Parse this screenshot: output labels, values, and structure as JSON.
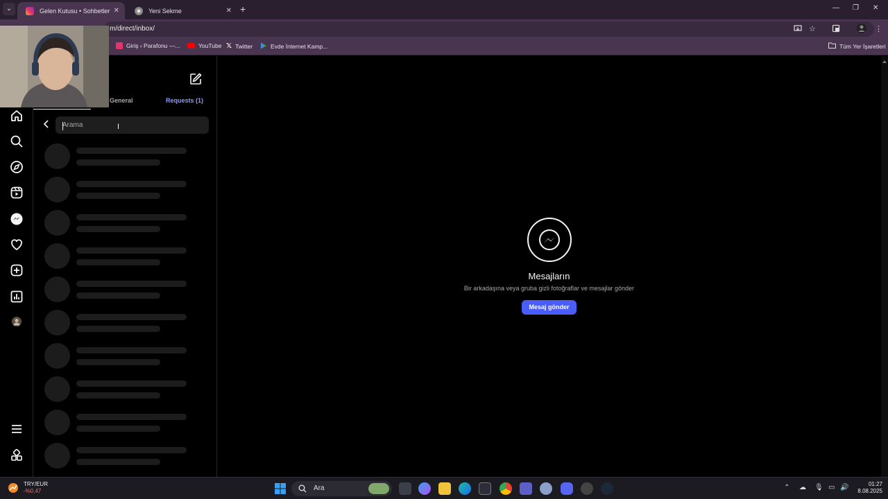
{
  "browser": {
    "tabs": [
      {
        "title": "Gelen Kutusu • Sohbetler",
        "active": true
      },
      {
        "title": "Yeni Sekme",
        "active": false
      }
    ],
    "new_tab_symbol": "+",
    "url": "m/direct/inbox/",
    "bookmarks": [
      {
        "label": "Giriş ‹ Parafonu —...",
        "icon": "parafonu-icon"
      },
      {
        "label": "YouTube",
        "icon": "youtube-icon"
      },
      {
        "label": "Twitter",
        "icon": "x-icon"
      },
      {
        "label": "Evde İnternet Kamp...",
        "icon": "play-store-icon"
      }
    ],
    "all_bookmarks_label": "Tüm Yer İşaretleri"
  },
  "inbox": {
    "tabs": {
      "general": "General",
      "requests": "Requests (1)"
    },
    "search_placeholder": "Arama"
  },
  "empty_state": {
    "title": "Mesajların",
    "subtitle": "Bir arkadaşına veya gruba gizli fotoğraflar ve mesajlar gönder",
    "button": "Mesaj gönder"
  },
  "taskbar": {
    "stock_symbol": "TRY/EUR",
    "stock_change": "-%0,47",
    "search_label": "Ara",
    "time": "01:27",
    "date": "8.08.2025"
  },
  "colors": {
    "accent_button": "#4a5df9",
    "requests_link": "#8c9aff",
    "chrome_frame": "#4a3550"
  }
}
